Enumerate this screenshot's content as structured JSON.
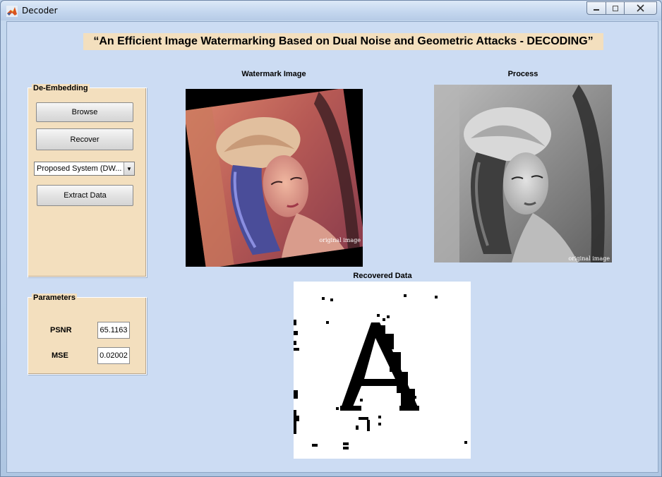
{
  "window": {
    "title": "Decoder",
    "icon": "matlab-icon",
    "controls": {
      "minimize": "minimize-icon",
      "maximize": "maximize-icon",
      "close": "close-icon"
    }
  },
  "main_title": "“An Efficient Image Watermarking Based on Dual Noise and Geometric Attacks - DECODING”",
  "de_embedding": {
    "title": "De-Embedding",
    "browse_label": "Browse",
    "recover_label": "Recover",
    "method_selected": "Proposed System (DW...",
    "extract_label": "Extract Data"
  },
  "parameters": {
    "title": "Parameters",
    "psnr_label": "PSNR",
    "psnr_value": "65.1163",
    "mse_label": "MSE",
    "mse_value": "0.02002"
  },
  "axes": {
    "watermark_title": "Watermark Image",
    "watermark_caption": "original image",
    "process_title": "Process",
    "process_caption": "original image",
    "recovered_title": "Recovered Data"
  },
  "colors": {
    "panel_bg": "#f3dfbe",
    "client_bg": "#ccdcf3"
  }
}
